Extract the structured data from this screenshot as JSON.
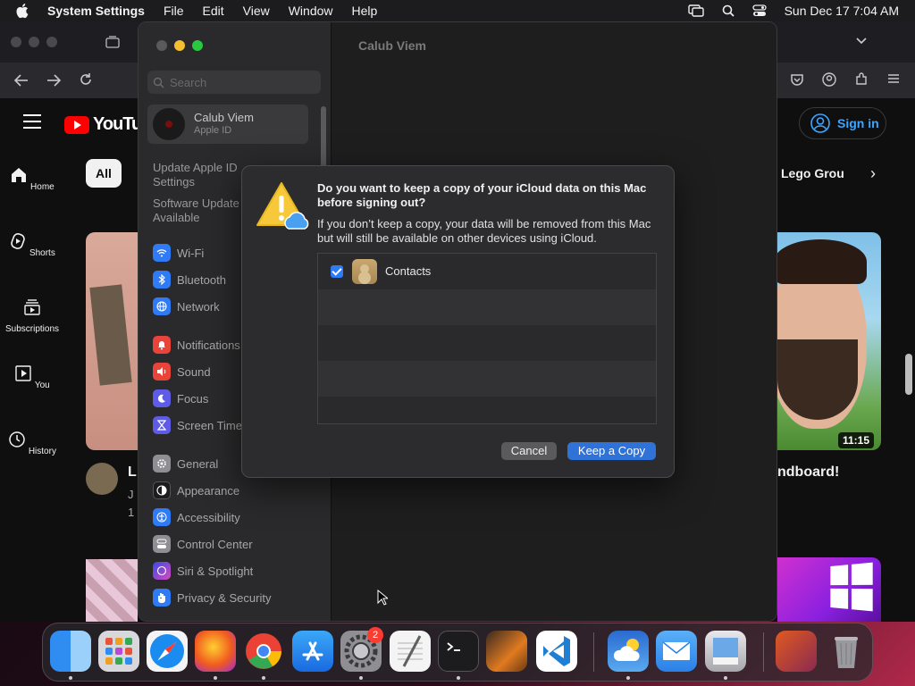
{
  "menubar": {
    "app_name": "System Settings",
    "items": [
      "File",
      "Edit",
      "View",
      "Window",
      "Help"
    ],
    "datetime": "Sun Dec 17  7:04 AM"
  },
  "browser": {
    "youtube_logo": "YouTube",
    "sign_in": "Sign in",
    "chip_all": "All",
    "chip_lego": "Lego Grou",
    "sidebar": [
      {
        "label": "Home",
        "icon": "home-icon"
      },
      {
        "label": "Shorts",
        "icon": "shorts-icon"
      },
      {
        "label": "Subscriptions",
        "icon": "subscriptions-icon"
      },
      {
        "label": "You",
        "icon": "you-icon"
      },
      {
        "label": "History",
        "icon": "history-icon"
      }
    ],
    "left_video": {
      "title": "L",
      "line1": "J",
      "line2": "1"
    },
    "right_video": {
      "title": "ndboard!",
      "duration": "11:15"
    }
  },
  "settings": {
    "search_placeholder": "Search",
    "account": {
      "name": "Calub Viem",
      "subtitle": "Apple ID"
    },
    "links": [
      "Update Apple ID Settings",
      "Software Update Available"
    ],
    "content_title": "Calub Viem",
    "items": [
      {
        "label": "Wi-Fi",
        "color": "#2f7bf5",
        "icon": "wifi-icon"
      },
      {
        "label": "Bluetooth",
        "color": "#2f7bf5",
        "icon": "bluetooth-icon"
      },
      {
        "label": "Network",
        "color": "#2f7bf5",
        "icon": "network-icon"
      },
      {
        "label": "Notifications",
        "color": "#e8443a",
        "icon": "notifications-icon"
      },
      {
        "label": "Sound",
        "color": "#e8443a",
        "icon": "sound-icon"
      },
      {
        "label": "Focus",
        "color": "#5e5ce6",
        "icon": "focus-icon"
      },
      {
        "label": "Screen Time",
        "color": "#5e5ce6",
        "icon": "screen-time-icon"
      },
      {
        "label": "General",
        "color": "#8e8e93",
        "icon": "general-icon"
      },
      {
        "label": "Appearance",
        "color": "#1c1c1e",
        "icon": "appearance-icon"
      },
      {
        "label": "Accessibility",
        "color": "#2f7bf5",
        "icon": "accessibility-icon"
      },
      {
        "label": "Control Center",
        "color": "#8e8e93",
        "icon": "control-center-icon"
      },
      {
        "label": "Siri & Spotlight",
        "color": "#b84ad8",
        "icon": "siri-icon"
      },
      {
        "label": "Privacy & Security",
        "color": "#2f7bf5",
        "icon": "privacy-icon"
      }
    ]
  },
  "dialog": {
    "question": "Do you want to keep a copy of your iCloud data on this Mac before signing out?",
    "description": "If you don’t keep a copy, your data will be removed from this Mac but will still be available on other devices using iCloud.",
    "list": [
      {
        "label": "Contacts",
        "checked": true
      }
    ],
    "cancel": "Cancel",
    "confirm": "Keep a Copy"
  },
  "dock": {
    "apps": [
      {
        "name": "finder-icon",
        "color": "#2f8cf0"
      },
      {
        "name": "launchpad-icon",
        "color": "#d8d8dc"
      },
      {
        "name": "safari-icon",
        "color": "#1a8cf0"
      },
      {
        "name": "firefox-icon",
        "color": "#f05a20"
      },
      {
        "name": "chrome-icon",
        "color": "#34a853"
      },
      {
        "name": "app-store-icon",
        "color": "#1a8cf0"
      },
      {
        "name": "system-settings-icon",
        "color": "#8e8e93"
      },
      {
        "name": "textedit-icon",
        "color": "#f0f0f0"
      },
      {
        "name": "terminal-icon",
        "color": "#1c1c1e"
      },
      {
        "name": "garageband-icon",
        "color": "#e07a20"
      },
      {
        "name": "vscode-icon",
        "color": "#1f7fd4"
      },
      {
        "name": "icloud-weather-icon",
        "color": "#3a8ad8"
      },
      {
        "name": "mail-icon",
        "color": "#3a9af0"
      },
      {
        "name": "preview-icon",
        "color": "#c8c8cc"
      },
      {
        "name": "downloads-stack-icon",
        "color": "#e05a20"
      },
      {
        "name": "trash-icon",
        "color": "#9a9a9e"
      }
    ],
    "settings_badge": "2"
  }
}
